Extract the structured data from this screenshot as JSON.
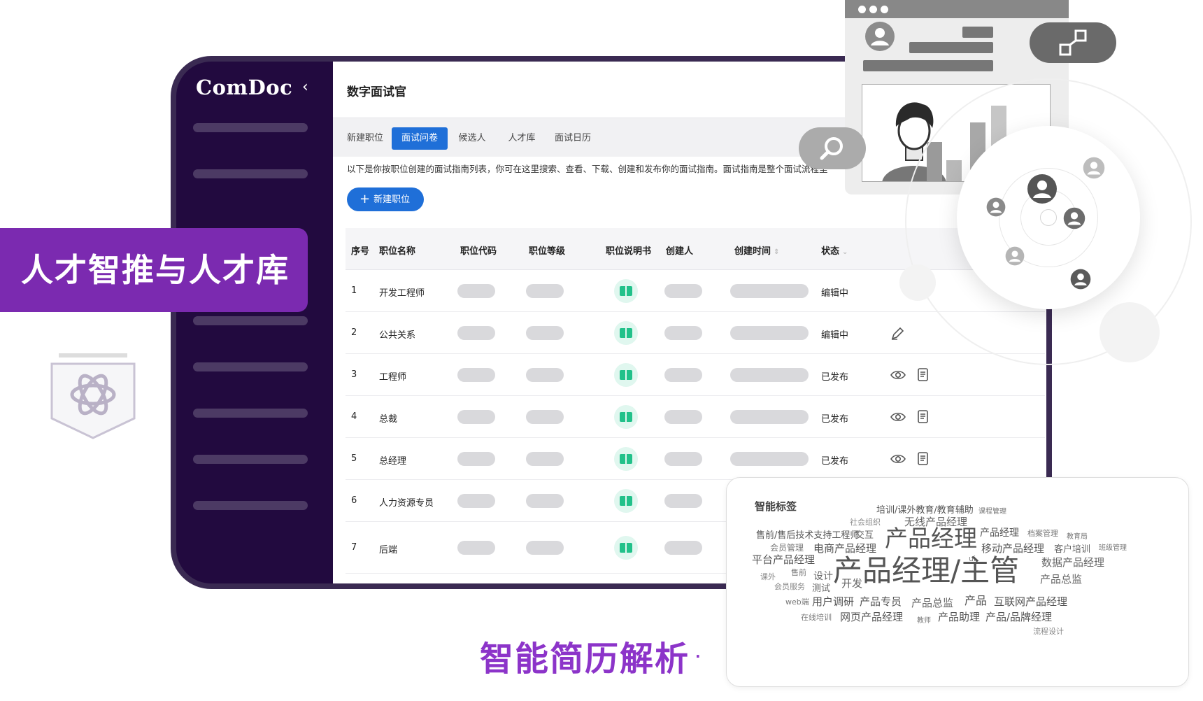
{
  "app": {
    "logo": "ComDoc",
    "collapse_icon": "‹",
    "title": "数字面试官"
  },
  "tabs": [
    {
      "label": "新建职位",
      "active": false
    },
    {
      "label": "面试问卷",
      "active": true
    },
    {
      "label": "候选人",
      "active": false
    },
    {
      "label": "人才库",
      "active": false
    },
    {
      "label": "面试日历",
      "active": false
    }
  ],
  "intro_text": "以下是你按职位创建的面试指南列表，你可在这里搜索、查看、下载、创建和发布你的面试指南。面试指南是整个面试流程里",
  "new_button": {
    "icon": "+",
    "label": "新建职位"
  },
  "table": {
    "headers": [
      "序号",
      "职位名称",
      "职位代码",
      "职位等级",
      "职位说明书",
      "创建人",
      "创建时间",
      "状态"
    ],
    "rows": [
      {
        "no": "1",
        "name": "开发工程师",
        "status": "编辑中",
        "actions": []
      },
      {
        "no": "2",
        "name": "公共关系",
        "status": "编辑中",
        "actions": [
          "edit"
        ]
      },
      {
        "no": "3",
        "name": "工程师",
        "status": "已发布",
        "actions": [
          "view",
          "copy"
        ]
      },
      {
        "no": "4",
        "name": "总裁",
        "status": "已发布",
        "actions": [
          "view",
          "copy"
        ]
      },
      {
        "no": "5",
        "name": "总经理",
        "status": "已发布",
        "actions": [
          "view",
          "copy"
        ]
      },
      {
        "no": "6",
        "name": "人力资源专员",
        "status": "",
        "actions": []
      },
      {
        "no": "7",
        "name": "后端",
        "status": "",
        "actions": []
      }
    ]
  },
  "talent_label": "人才智推与人才库",
  "caption": {
    "text": "智能简历解析",
    "dot": "·"
  },
  "tag_cloud": {
    "title": "智能标签",
    "words": [
      "培训/课外教育/教育辅助",
      "课程管理",
      "社会组织",
      "无线产品经理",
      "售前/售后技术支持工程师",
      "交互",
      "产品经理",
      "产品经理",
      "档案管理",
      "教育局",
      "会员管理",
      "电商产品经理",
      "移动产品经理",
      "客户培训",
      "班级管理",
      "平台产品经理",
      "ui",
      "产品经理/主管",
      "数据产品经理",
      "课外",
      "售前",
      "设计",
      "开发",
      "产品总监",
      "会员服务",
      "测试",
      "web端",
      "用户调研",
      "产品专员",
      "产品总监",
      "产品",
      "互联网产品经理",
      "在线培训",
      "网页产品经理",
      "教师",
      "产品助理",
      "产品/品牌经理",
      "流程设计"
    ]
  },
  "colors": {
    "sidebar": "#220a3f",
    "primary": "#1f6fd8",
    "label_purple": "#7b2ab0",
    "caption_purple": "#8c34c9",
    "doc_green": "#22c18a"
  }
}
